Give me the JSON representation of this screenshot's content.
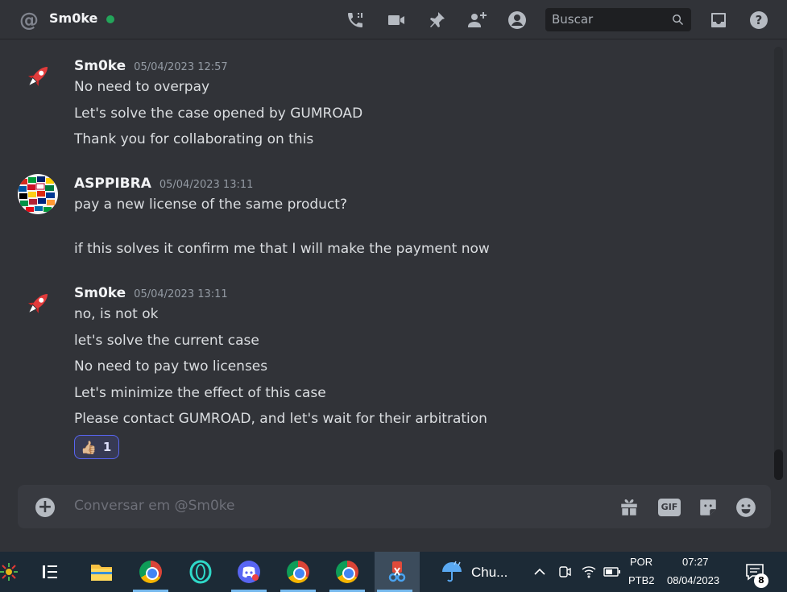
{
  "header": {
    "channel_name": "Sm0ke",
    "status": "online",
    "search_placeholder": "Buscar",
    "icons": [
      "at-sign-icon",
      "voice-call-icon",
      "video-call-icon",
      "pin-icon",
      "add-friend-icon",
      "user-profile-icon",
      "search-icon",
      "inbox-icon",
      "help-icon"
    ]
  },
  "messages": [
    {
      "author": "Sm0ke",
      "timestamp": "05/04/2023 12:57",
      "avatar": "rocket-avatar-icon",
      "lines": [
        "No need to overpay",
        "Let's solve the case opened by GUMROAD",
        "Thank you for collaborating on this"
      ]
    },
    {
      "author": "ASPPIBRA",
      "timestamp": "05/04/2023 13:11",
      "avatar": "flags-globe-avatar",
      "lines": [
        "pay a new license of the same product?",
        "",
        "if this solves it confirm me that I will make the payment now"
      ]
    },
    {
      "author": "Sm0ke",
      "timestamp": "05/04/2023 13:11",
      "avatar": "rocket-avatar-icon",
      "lines": [
        "no, is not ok",
        "let's solve the current case",
        "No need to pay two licenses",
        "Let's minimize the effect of this case",
        "Please contact GUMROAD, and let's wait for their arbitration"
      ],
      "reaction": {
        "emoji": "👍🏼",
        "count": "1"
      }
    }
  ],
  "composer": {
    "placeholder": "Conversar em @Sm0ke",
    "gif_label": "GIF",
    "icons": [
      "add-attachment-icon",
      "gift-icon",
      "gif-icon",
      "sticker-icon",
      "emoji-icon"
    ]
  },
  "taskbar": {
    "weather_text": "Chu...",
    "language": "POR",
    "keyboard": "PTB2",
    "time": "07:27",
    "date": "08/04/2023",
    "notification_count": "8",
    "colors": {
      "accent": "#76b9ed",
      "background": "#1c2a36"
    }
  }
}
